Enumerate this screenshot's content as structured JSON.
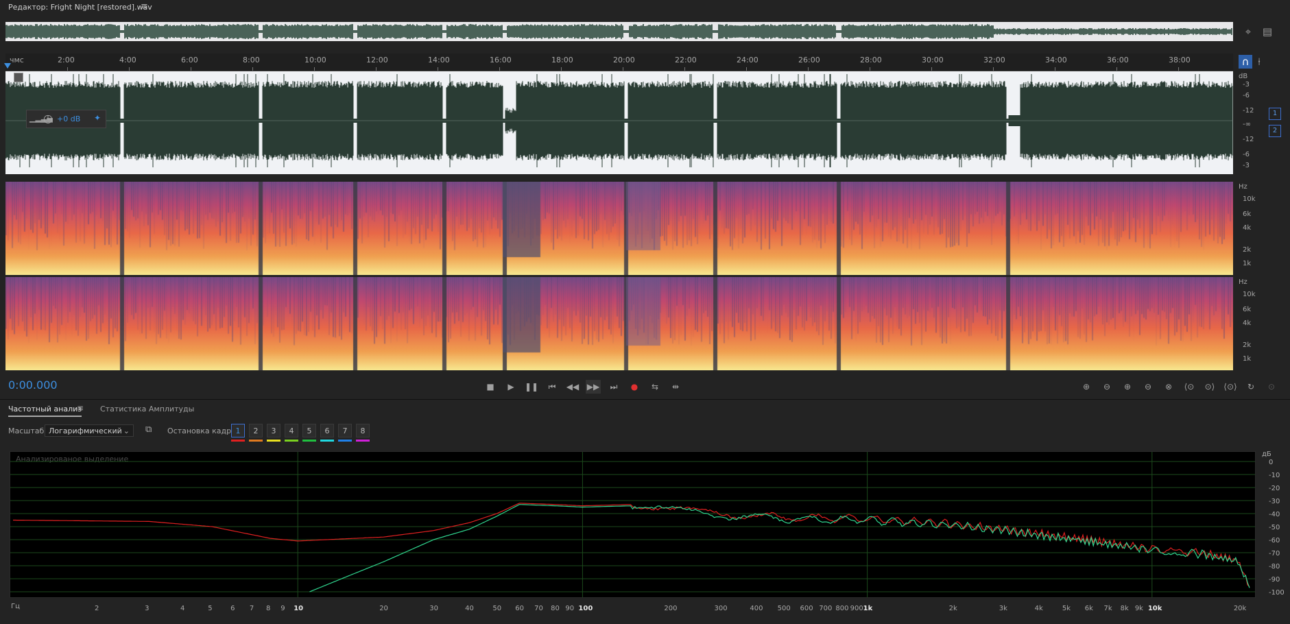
{
  "titlebar": {
    "title": "Редактор: Fright Night [restored].wav",
    "menu_icon": "hamburger-icon"
  },
  "ruler": {
    "start_label": "чмс",
    "ticks": [
      "2:00",
      "4:00",
      "6:00",
      "8:00",
      "10:00",
      "12:00",
      "14:00",
      "16:00",
      "18:00",
      "20:00",
      "22:00",
      "24:00",
      "26:00",
      "28:00",
      "30:00",
      "32:00",
      "34:00",
      "36:00",
      "38:00"
    ]
  },
  "hud": {
    "gain": "+0 dB"
  },
  "db_scale": {
    "unit": "dB",
    "labels": [
      "-3",
      "-6",
      "-12",
      "-∞",
      "-12",
      "-6",
      "-3"
    ]
  },
  "channels": [
    "1",
    "2"
  ],
  "hz_scale": {
    "unit": "Hz",
    "labels": [
      "10k",
      "6k",
      "4k",
      "2k",
      "1k"
    ]
  },
  "transport": {
    "timecode": "0:00.000"
  },
  "tabs": [
    {
      "label": "Частотный анализ",
      "active": true
    },
    {
      "label": "Статистика Амплитуды",
      "active": false
    }
  ],
  "controls": {
    "scale_label": "Масштаб:",
    "scale_value": "Логарифмический",
    "freeze_label": "Остановка кадра:",
    "frames": [
      "1",
      "2",
      "3",
      "4",
      "5",
      "6",
      "7",
      "8"
    ],
    "frame_colors": [
      "#e02020",
      "#e07a20",
      "#e8e020",
      "#7ad020",
      "#20c040",
      "#20d8e0",
      "#2080e8",
      "#d020d8"
    ]
  },
  "graph": {
    "overlay_label": "Анализированое выделение",
    "y_unit": "дБ",
    "y_labels": [
      "0",
      "-10",
      "-20",
      "-30",
      "-40",
      "-50",
      "-60",
      "-70",
      "-80",
      "-90",
      "-100"
    ],
    "x_unit": "Гц",
    "x_labels": [
      {
        "t": "2",
        "f": 2
      },
      {
        "t": "3",
        "f": 3
      },
      {
        "t": "4",
        "f": 4
      },
      {
        "t": "5",
        "f": 5
      },
      {
        "t": "6",
        "f": 6
      },
      {
        "t": "7",
        "f": 7
      },
      {
        "t": "8",
        "f": 8
      },
      {
        "t": "9",
        "f": 9
      },
      {
        "t": "10",
        "f": 10,
        "b": true
      },
      {
        "t": "20",
        "f": 20
      },
      {
        "t": "30",
        "f": 30
      },
      {
        "t": "40",
        "f": 40
      },
      {
        "t": "50",
        "f": 50
      },
      {
        "t": "60",
        "f": 60
      },
      {
        "t": "70",
        "f": 70
      },
      {
        "t": "80",
        "f": 80
      },
      {
        "t": "90",
        "f": 90
      },
      {
        "t": "100",
        "f": 100,
        "b": true
      },
      {
        "t": "200",
        "f": 200
      },
      {
        "t": "300",
        "f": 300
      },
      {
        "t": "400",
        "f": 400
      },
      {
        "t": "500",
        "f": 500
      },
      {
        "t": "600",
        "f": 600
      },
      {
        "t": "700",
        "f": 700
      },
      {
        "t": "800",
        "f": 800
      },
      {
        "t": "900",
        "f": 900
      },
      {
        "t": "1k",
        "f": 1000,
        "b": true
      },
      {
        "t": "2k",
        "f": 2000
      },
      {
        "t": "3k",
        "f": 3000
      },
      {
        "t": "4k",
        "f": 4000
      },
      {
        "t": "5k",
        "f": 5000
      },
      {
        "t": "6k",
        "f": 6000
      },
      {
        "t": "7k",
        "f": 7000
      },
      {
        "t": "8k",
        "f": 8000
      },
      {
        "t": "9k",
        "f": 9000
      },
      {
        "t": "10k",
        "f": 10000,
        "b": true
      },
      {
        "t": "20k",
        "f": 20000
      }
    ]
  },
  "chart_data": {
    "type": "line",
    "xscale": "log",
    "xlim": [
      1,
      22000
    ],
    "ylim": [
      -100,
      5
    ],
    "series": [
      {
        "color": "#e02020",
        "points": [
          [
            1,
            -45
          ],
          [
            3,
            -46
          ],
          [
            5,
            -50
          ],
          [
            8,
            -59
          ],
          [
            10,
            -61
          ],
          [
            20,
            -58
          ],
          [
            30,
            -53
          ],
          [
            40,
            -47
          ],
          [
            50,
            -40
          ],
          [
            60,
            -32
          ],
          [
            80,
            -33
          ],
          [
            100,
            -34
          ],
          [
            150,
            -33
          ],
          [
            200,
            -36
          ],
          [
            300,
            -40
          ],
          [
            500,
            -43
          ],
          [
            1000,
            -44
          ],
          [
            2000,
            -48
          ],
          [
            3000,
            -52
          ],
          [
            5000,
            -58
          ],
          [
            8000,
            -64
          ],
          [
            10000,
            -67
          ],
          [
            15000,
            -70
          ],
          [
            20000,
            -76
          ],
          [
            22000,
            -96
          ]
        ]
      },
      {
        "color": "#30d890",
        "points": [
          [
            11,
            -100
          ],
          [
            15,
            -88
          ],
          [
            20,
            -77
          ],
          [
            30,
            -60
          ],
          [
            40,
            -52
          ],
          [
            50,
            -42
          ],
          [
            60,
            -33
          ],
          [
            80,
            -34
          ],
          [
            100,
            -35
          ],
          [
            150,
            -34
          ],
          [
            200,
            -37
          ],
          [
            300,
            -41
          ],
          [
            500,
            -44
          ],
          [
            1000,
            -45
          ],
          [
            2000,
            -49
          ],
          [
            3000,
            -53
          ],
          [
            5000,
            -59
          ],
          [
            8000,
            -65
          ],
          [
            10000,
            -68
          ],
          [
            15000,
            -71
          ],
          [
            20000,
            -77
          ],
          [
            22000,
            -97
          ]
        ]
      }
    ]
  }
}
